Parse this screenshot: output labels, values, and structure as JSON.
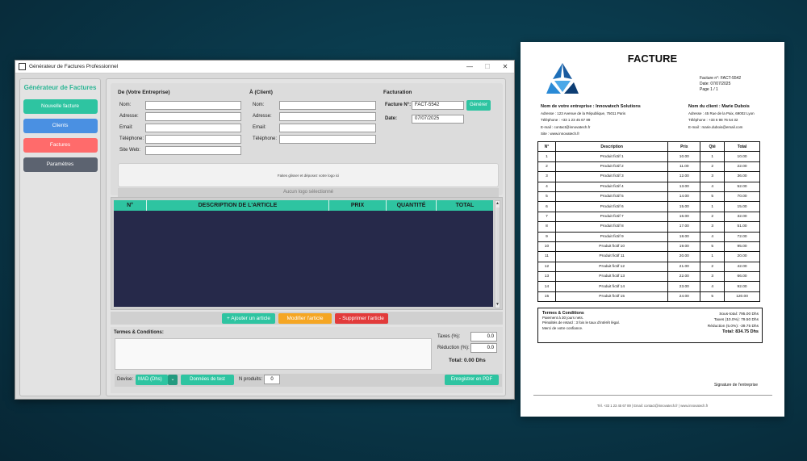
{
  "window": {
    "title": "Générateur de Factures Professionnel",
    "min": "—",
    "max": "☐",
    "close": "✕"
  },
  "sidebar": {
    "brand": "Générateur de Factures",
    "items": [
      {
        "label": "Nouvelle facture",
        "color": "#2ec4a1"
      },
      {
        "label": "Clients",
        "color": "#4a90e2"
      },
      {
        "label": "Factures",
        "color": "#ff6b6b"
      },
      {
        "label": "Paramètres",
        "color": "#5c6370"
      }
    ]
  },
  "form": {
    "from": {
      "title": "De (Votre Entreprise)",
      "labels": [
        "Nom:",
        "Adresse:",
        "Email:",
        "Téléphone:",
        "Site Web:"
      ]
    },
    "to": {
      "title": "À (Client)",
      "labels": [
        "Nom:",
        "Adresse:",
        "Email:",
        "Téléphone:"
      ]
    },
    "billing": {
      "title": "Facturation",
      "invoice_label": "Facture N°:",
      "invoice_value": "FACT-5542",
      "generate": "Générer",
      "date_label": "Date:",
      "date_value": "07/07/2025"
    },
    "dropzone": "Faites glisser et déposez votre logo ici",
    "no_logo": "Aucun logo sélectionné"
  },
  "table": {
    "headers": [
      "N°",
      "DESCRIPTION DE L'ARTICLE",
      "PRIX",
      "QUANTITÉ",
      "TOTAL"
    ]
  },
  "actions": {
    "add": "+ Ajouter un article",
    "edit": "Modifier l'article",
    "delete": "- Supprimer l'article"
  },
  "bottom": {
    "terms_label": "Termes & Conditions:",
    "taxes_label": "Taxes (%):",
    "taxes_value": "0.0",
    "discount_label": "Réduction (%):",
    "discount_value": "0.0",
    "total": "Total: 0.00 Dhs",
    "currency_label": "Devise:",
    "currency_value": "MAD (Dhs)",
    "test_data": "Données de test",
    "products_label": "N produits:",
    "products_value": "0",
    "save_pdf": "Enregistrer en PDF"
  },
  "invoice": {
    "title": "FACTURE",
    "meta": [
      "Facture n°: FACT-5542",
      "Date: 07/07/2025",
      "Page 1 / 1"
    ],
    "company": {
      "name": "Nom de votre entreprise : Innovatech Solutions",
      "lines": [
        "Adresse : 123 Avenue de la République, 75011 Paris",
        "Téléphone : +33 1 23 45 67 89",
        "E-mail : contact@innovatech.fr",
        "Site : www.innovatech.fr"
      ]
    },
    "client": {
      "name": "Nom du client : Marie Dubois",
      "lines": [
        "Adresse : 45 Rue de la Paix, 69002 Lyon",
        "Téléphone : +33 6 98 76 54 32",
        "E-mail : marie.dubois@email.com"
      ]
    },
    "headers": [
      "N°",
      "Description",
      "Prix",
      "Qté",
      "Total"
    ],
    "rows": [
      [
        "1",
        "Produit fictif 1",
        "10.00",
        "1",
        "10.00"
      ],
      [
        "2",
        "Produit fictif 2",
        "11.00",
        "2",
        "22.00"
      ],
      [
        "3",
        "Produit fictif 3",
        "12.00",
        "3",
        "36.00"
      ],
      [
        "4",
        "Produit fictif 4",
        "13.00",
        "4",
        "52.00"
      ],
      [
        "5",
        "Produit fictif 5",
        "14.00",
        "5",
        "70.00"
      ],
      [
        "6",
        "Produit fictif 6",
        "15.00",
        "1",
        "15.00"
      ],
      [
        "7",
        "Produit fictif 7",
        "16.00",
        "2",
        "32.00"
      ],
      [
        "8",
        "Produit fictif 8",
        "17.00",
        "3",
        "51.00"
      ],
      [
        "9",
        "Produit fictif 9",
        "18.00",
        "4",
        "72.00"
      ],
      [
        "10",
        "Produit fictif 10",
        "19.00",
        "5",
        "95.00"
      ],
      [
        "11",
        "Produit fictif 11",
        "20.00",
        "1",
        "20.00"
      ],
      [
        "12",
        "Produit fictif 12",
        "21.00",
        "2",
        "42.00"
      ],
      [
        "13",
        "Produit fictif 13",
        "22.00",
        "3",
        "66.00"
      ],
      [
        "14",
        "Produit fictif 14",
        "23.00",
        "4",
        "92.00"
      ],
      [
        "15",
        "Produit fictif 15",
        "24.00",
        "5",
        "120.00"
      ]
    ],
    "terms_title": "Termes & Conditions",
    "terms_lines": [
      "Paiement à 30 jours nets.",
      "Pénalités de retard : 3 fois le taux d'intérêt légal.",
      "Merci de votre confiance."
    ],
    "totals": [
      "Sous-total: 795.00 Dhs",
      "Taxes (10.0%): 79.50 Dhs",
      "Réduction (5.0%): -39.75 Dhs"
    ],
    "grand_total": "Total: 834.75 Dhs",
    "signature": "Signature de l'entreprise",
    "footer": "Tél. +33 1 23 45 67 89    |    Email: contact@innovatech.fr    |    www.innovatech.fr"
  }
}
